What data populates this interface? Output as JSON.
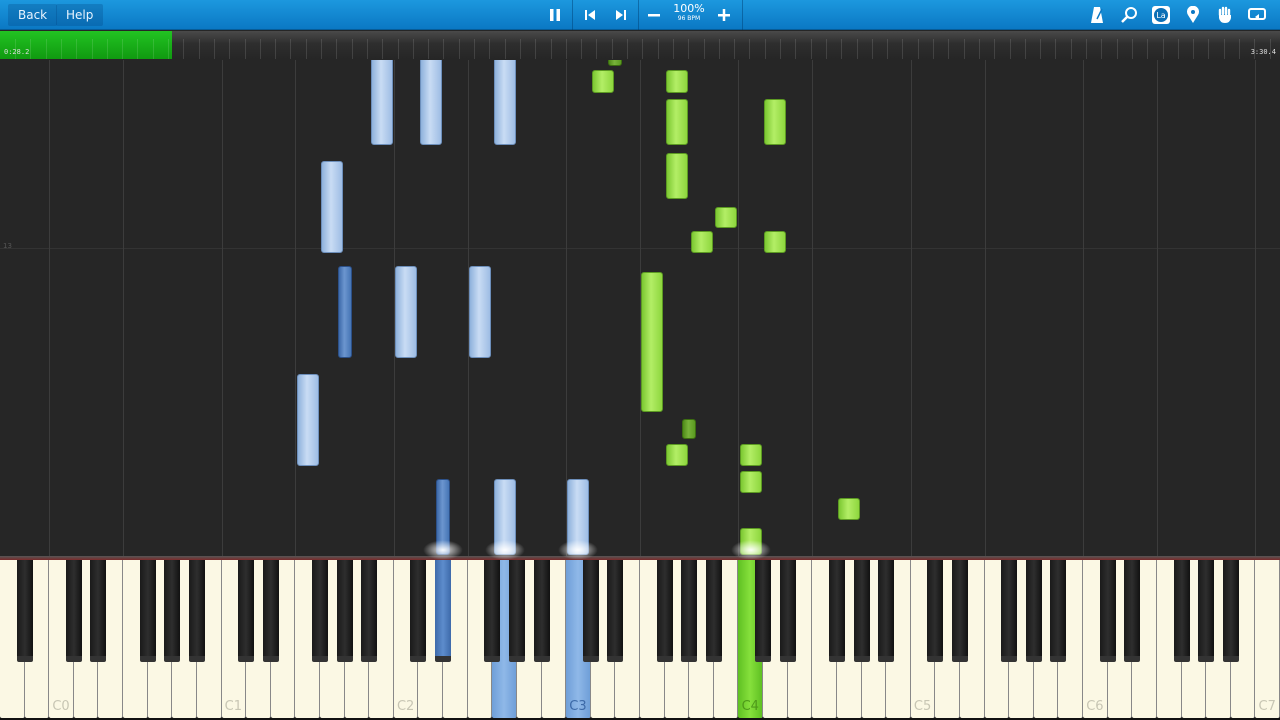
{
  "toolbar": {
    "back_label": "Back",
    "help_label": "Help",
    "speed_percent": "100%",
    "tempo": "96 BPM",
    "icons": [
      "pause-icon",
      "skip-back-icon",
      "skip-forward-icon",
      "minus-icon",
      "plus-icon",
      "metronome-icon",
      "search-icon",
      "note-labels-icon",
      "marker-icon",
      "hand-icon",
      "loop-icon"
    ],
    "note_labels_text": "La"
  },
  "timeline": {
    "current_time": "0:28.2",
    "total_time": "3:30.4",
    "progress": 0.134
  },
  "roll": {
    "measure_label": "13"
  },
  "colors": {
    "left_hand": "#a9c6ec",
    "right_hand": "#98dd48",
    "toolbar": "#1287d0",
    "progress": "#18b018"
  },
  "keyboard": {
    "octave_labels": [
      "C0",
      "C1",
      "C2",
      "C3",
      "C4",
      "C5",
      "C6",
      "C7"
    ],
    "pressed_keys": [
      {
        "key": "D#2",
        "hand": "left"
      },
      {
        "key": "G2",
        "hand": "left"
      },
      {
        "key": "C3",
        "hand": "left"
      },
      {
        "key": "C4",
        "hand": "right"
      }
    ]
  },
  "notes": [
    {
      "key": "B1",
      "hand": "left",
      "start": 15.2,
      "beats": 3.5
    },
    {
      "key": "D2",
      "hand": "left",
      "start": 15.2,
      "beats": 3.5
    },
    {
      "key": "G2",
      "hand": "left",
      "start": 15.2,
      "beats": 3.5
    },
    {
      "key": "G1",
      "hand": "left",
      "start": 11.2,
      "beats": 3.4
    },
    {
      "key": "G#1",
      "hand": "left",
      "start": 7.3,
      "beats": 3.4
    },
    {
      "key": "C2",
      "hand": "left",
      "start": 7.3,
      "beats": 3.4
    },
    {
      "key": "F2",
      "hand": "left",
      "start": 7.3,
      "beats": 3.4
    },
    {
      "key": "F1",
      "hand": "left",
      "start": 3.3,
      "beats": 3.4
    },
    {
      "key": "D#2",
      "hand": "left",
      "start": 0,
      "beats": 2.8
    },
    {
      "key": "G2",
      "hand": "left",
      "start": 0,
      "beats": 2.8
    },
    {
      "key": "C3",
      "hand": "left",
      "start": 0,
      "beats": 2.8
    },
    {
      "key": "D#3",
      "hand": "right",
      "start": 18.1,
      "beats": 0.4
    },
    {
      "key": "D3",
      "hand": "right",
      "start": 17.1,
      "beats": 0.85
    },
    {
      "key": "G3",
      "hand": "right",
      "start": 17.1,
      "beats": 0.85
    },
    {
      "key": "G3",
      "hand": "right",
      "start": 15.2,
      "beats": 1.7
    },
    {
      "key": "D4",
      "hand": "right",
      "start": 15.2,
      "beats": 1.7
    },
    {
      "key": "G3",
      "hand": "right",
      "start": 13.2,
      "beats": 1.7
    },
    {
      "key": "B3",
      "hand": "right",
      "start": 12.1,
      "beats": 0.8
    },
    {
      "key": "A3",
      "hand": "right",
      "start": 11.2,
      "beats": 0.8
    },
    {
      "key": "D4",
      "hand": "right",
      "start": 11.2,
      "beats": 0.8
    },
    {
      "key": "F3",
      "hand": "right",
      "start": 5.3,
      "beats": 5.2
    },
    {
      "key": "G#3",
      "hand": "right",
      "start": 4.3,
      "beats": 0.75
    },
    {
      "key": "G3",
      "hand": "right",
      "start": 3.3,
      "beats": 0.8
    },
    {
      "key": "C4",
      "hand": "right",
      "start": 3.3,
      "beats": 0.8
    },
    {
      "key": "C4",
      "hand": "right",
      "start": 2.3,
      "beats": 0.8
    },
    {
      "key": "G4",
      "hand": "right",
      "start": 1.3,
      "beats": 0.8
    },
    {
      "key": "C4",
      "hand": "right",
      "start": 0,
      "beats": 1.0
    }
  ]
}
